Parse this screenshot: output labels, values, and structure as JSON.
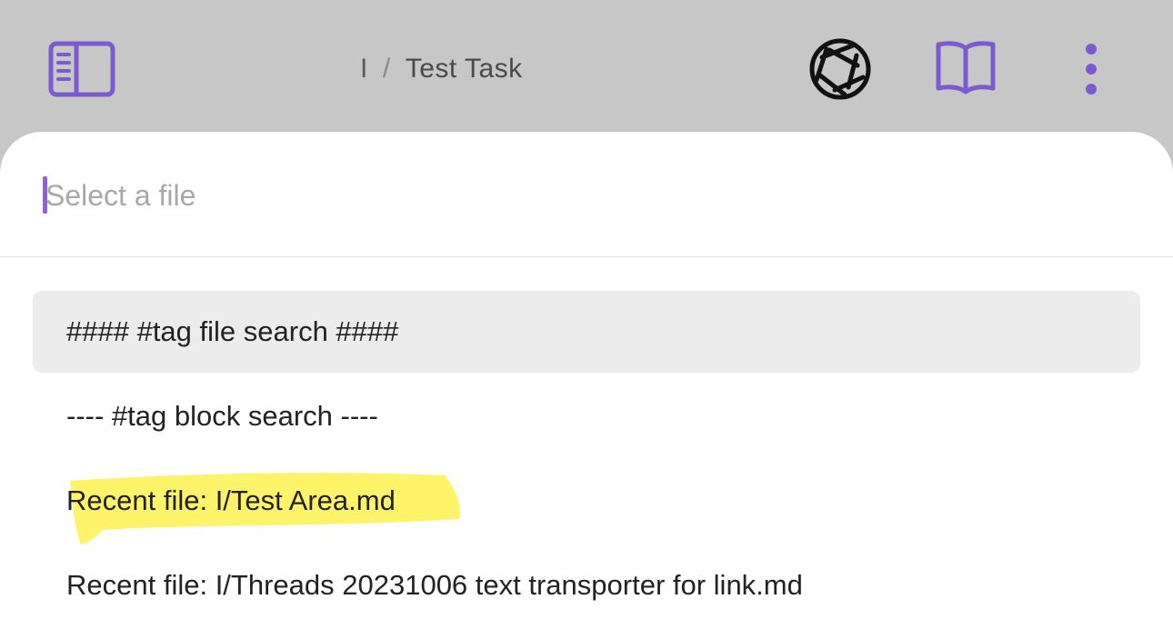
{
  "header": {
    "breadcrumb_folder": "I",
    "breadcrumb_separator": "/",
    "breadcrumb_current": "Test Task",
    "icons": [
      "sidebar-toggle-icon",
      "camera-aperture-icon",
      "book-open-icon",
      "more-vertical-icon"
    ],
    "accent_color": "#7c5bd1"
  },
  "search": {
    "placeholder": "Select a file",
    "value": ""
  },
  "results": [
    {
      "label": "#### #tag file search ####",
      "selected": true
    },
    {
      "label": "---- #tag block search ----",
      "selected": false
    },
    {
      "label": "Recent file: I/Test Area.md",
      "selected": false,
      "highlighted": true,
      "highlight_color": "#fff36a"
    },
    {
      "label": "Recent file: I/Threads 20231006 text transporter for link.md",
      "selected": false
    }
  ]
}
